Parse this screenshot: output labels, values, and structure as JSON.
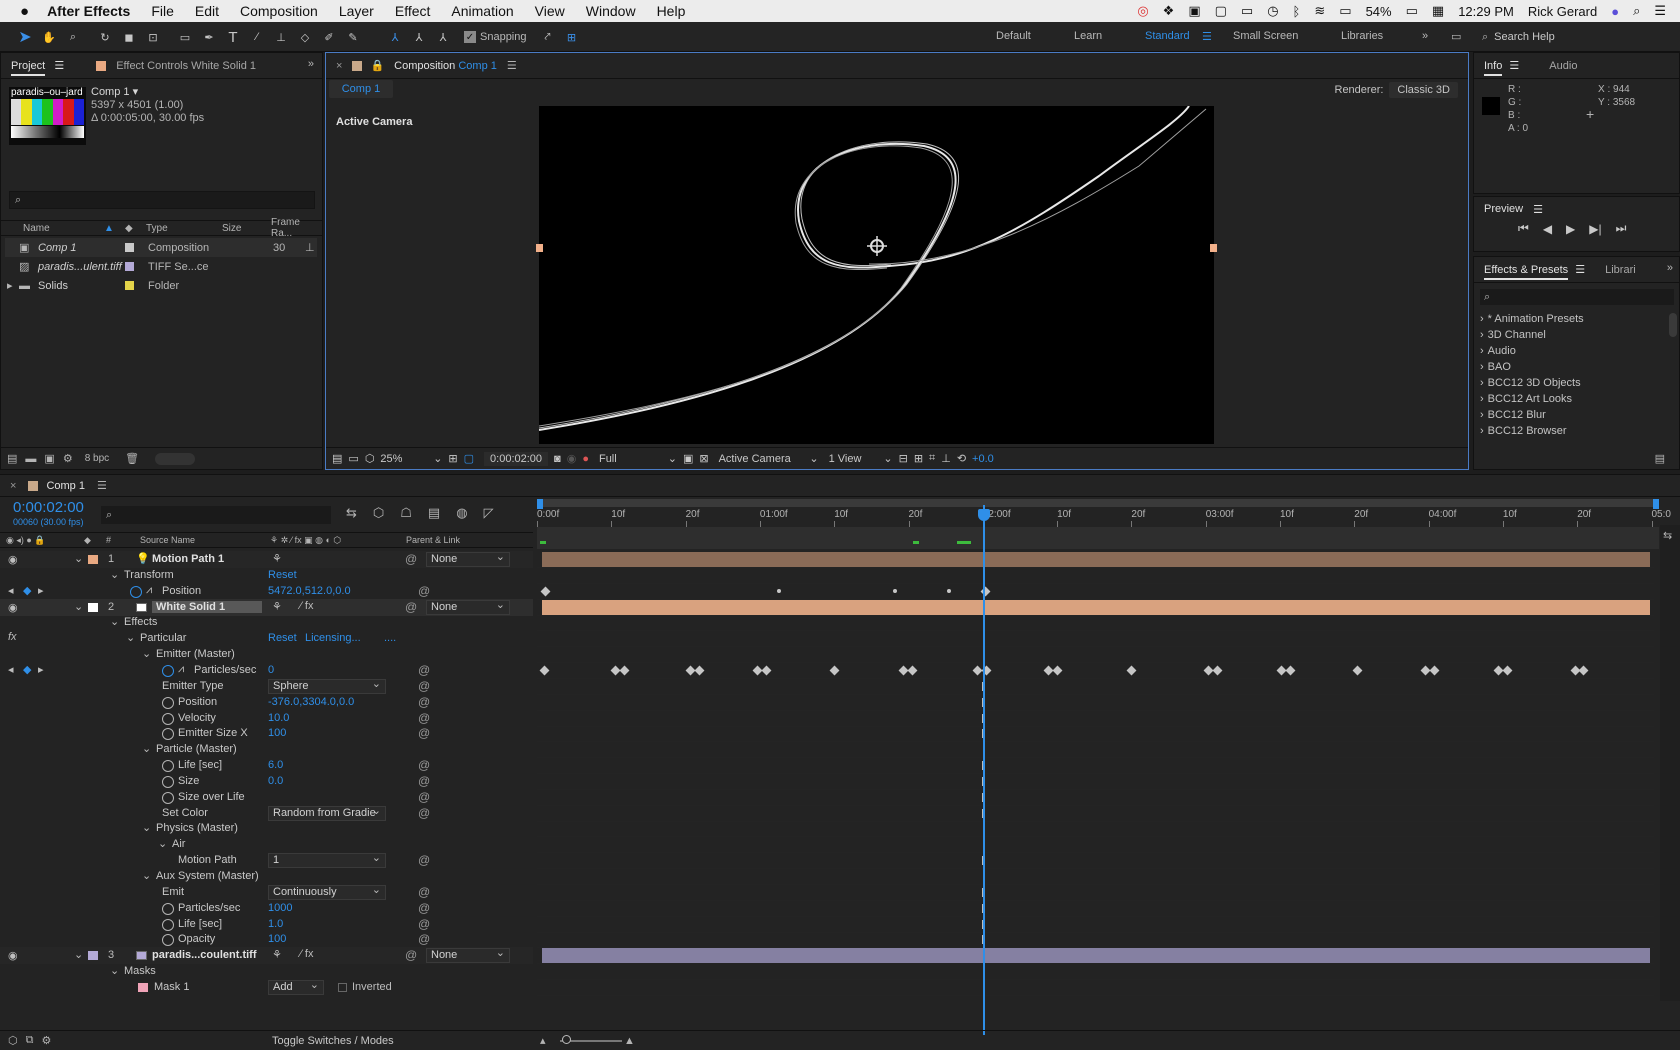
{
  "menubar": {
    "app_name": "After Effects",
    "menus": [
      "File",
      "Edit",
      "Composition",
      "Layer",
      "Effect",
      "Animation",
      "View",
      "Window",
      "Help"
    ],
    "battery": "54%",
    "clock": "12:29 PM",
    "user": "Rick Gerard"
  },
  "toolbar": {
    "snapping_label": "Snapping",
    "workspaces": [
      "Default",
      "Learn",
      "Standard",
      "Small Screen",
      "Libraries"
    ],
    "active_workspace": "Standard",
    "search_placeholder": "Search Help"
  },
  "project_panel": {
    "tab_project": "Project",
    "tab_effect_controls": "Effect Controls White Solid 1",
    "thumb_label": "paradis–ou–jard",
    "comp_name": "Comp 1 ▾",
    "comp_size": "5397 x 4501 (1.00)",
    "comp_duration": "Δ 0:00:05:00, 30.00 fps",
    "columns": [
      "Name",
      "Type",
      "Size",
      "Frame Ra..."
    ],
    "items": [
      {
        "name": "Comp 1",
        "type": "Composition",
        "size": "",
        "fps": "30",
        "color": "#c9c9c9"
      },
      {
        "name": "paradis...ulent.tiff",
        "type": "TIFF Se...ce",
        "size": "",
        "fps": "",
        "color": "#b3a9d6"
      },
      {
        "name": "Solids",
        "type": "Folder",
        "size": "",
        "fps": "",
        "color": "#e4d44a"
      }
    ],
    "bpc": "8 bpc"
  },
  "composition_panel": {
    "tab_prefix": "Composition",
    "tab_comp": "Comp 1",
    "subtab": "Comp 1",
    "renderer_label": "Renderer:",
    "renderer_value": "Classic 3D",
    "view_label": "Active Camera",
    "zoom": "25%",
    "timecode": "0:00:02:00",
    "resolution": "Full",
    "camera": "Active Camera",
    "views": "1 View",
    "exposure": "+0.0"
  },
  "info_panel": {
    "tab_info": "Info",
    "tab_audio": "Audio",
    "r": "R :",
    "g": "G :",
    "b": "B :",
    "a": "A :  0",
    "x": "X : 944",
    "y": "Y : 3568"
  },
  "preview_panel": {
    "title": "Preview"
  },
  "effects_panel": {
    "tab": "Effects & Presets",
    "tab2": "Librari",
    "items": [
      "* Animation Presets",
      "3D Channel",
      "Audio",
      "BAO",
      "BCC12 3D Objects",
      "BCC12 Art Looks",
      "BCC12 Blur",
      "BCC12 Browser"
    ]
  },
  "timeline": {
    "tab": "Comp 1",
    "timecode": "0:00:02:00",
    "frames": "00060 (30.00 fps)",
    "col_source": "Source Name",
    "col_parent": "Parent & Link",
    "ruler": [
      "0:00f",
      "10f",
      "20f",
      "01:00f",
      "10f",
      "20f",
      "02:00f",
      "10f",
      "20f",
      "03:00f",
      "10f",
      "20f",
      "04:00f",
      "10f",
      "20f",
      "05:0"
    ],
    "toggle_label": "Toggle Switches / Modes",
    "rows": [
      {
        "indent": 0,
        "num": "1",
        "name": "Motion Path 1",
        "kind": "layer",
        "parent": "None",
        "color": "#e9a982"
      },
      {
        "indent": 1,
        "name": "Transform",
        "value": "Reset",
        "kind": "group"
      },
      {
        "indent": 2,
        "name": "Position",
        "value": "5472.0,512.0,0.0",
        "kind": "prop",
        "stopwatch": true,
        "graph": true,
        "keynav": true
      },
      {
        "indent": 0,
        "num": "2",
        "name": "White Solid 1",
        "kind": "layer",
        "parent": "None",
        "color": "#ffffff",
        "selected": true
      },
      {
        "indent": 1,
        "name": "Effects",
        "kind": "group"
      },
      {
        "indent": 2,
        "name": "Particular",
        "value": "Reset",
        "value2": "Licensing...",
        "value3": "....",
        "kind": "group",
        "fx": true
      },
      {
        "indent": 3,
        "name": "Emitter (Master)",
        "kind": "group"
      },
      {
        "indent": 4,
        "name": "Particles/sec",
        "value": "0",
        "kind": "prop",
        "stopwatch": true,
        "graph": true,
        "keynav": true
      },
      {
        "indent": 4,
        "name": "Emitter Type",
        "dropdown": "Sphere",
        "kind": "prop"
      },
      {
        "indent": 4,
        "name": "Position",
        "value": "-376.0,3304.0,0.0",
        "kind": "prop",
        "stopwatch": true
      },
      {
        "indent": 4,
        "name": "Velocity",
        "value": "10.0",
        "kind": "prop",
        "stopwatch": true
      },
      {
        "indent": 4,
        "name": "Emitter Size X",
        "value": "100",
        "kind": "prop",
        "stopwatch": true
      },
      {
        "indent": 3,
        "name": "Particle (Master)",
        "kind": "group"
      },
      {
        "indent": 4,
        "name": "Life [sec]",
        "value": "6.0",
        "kind": "prop",
        "stopwatch": true
      },
      {
        "indent": 4,
        "name": "Size",
        "value": "0.0",
        "kind": "prop",
        "stopwatch": true
      },
      {
        "indent": 4,
        "name": "Size over Life",
        "kind": "prop",
        "stopwatch": true
      },
      {
        "indent": 4,
        "name": "Set Color",
        "dropdown": "Random from Gradie",
        "kind": "prop",
        "nostop": true
      },
      {
        "indent": 3,
        "name": "Physics (Master)",
        "kind": "group"
      },
      {
        "indent": 4,
        "name": "Air",
        "kind": "group"
      },
      {
        "indent": 5,
        "name": "Motion Path",
        "dropdown": "1",
        "kind": "prop",
        "nostop": true
      },
      {
        "indent": 3,
        "name": "Aux System (Master)",
        "kind": "group"
      },
      {
        "indent": 4,
        "name": "Emit",
        "dropdown": "Continuously",
        "kind": "prop",
        "nostop": true
      },
      {
        "indent": 4,
        "name": "Particles/sec",
        "value": "1000",
        "kind": "prop",
        "stopwatch": true
      },
      {
        "indent": 4,
        "name": "Life [sec]",
        "value": "1.0",
        "kind": "prop",
        "stopwatch": true
      },
      {
        "indent": 4,
        "name": "Opacity",
        "value": "100",
        "kind": "prop",
        "stopwatch": true
      },
      {
        "indent": 0,
        "num": "3",
        "name": "paradis...coulent.tiff",
        "kind": "layer",
        "parent": "None",
        "color": "#b3a9d6"
      },
      {
        "indent": 1,
        "name": "Masks",
        "kind": "group"
      },
      {
        "indent": 2,
        "name": "Mask 1",
        "dropdown": "Add",
        "extra": "Inverted",
        "kind": "prop",
        "nostop": true,
        "maskcolor": "#f0a4b8"
      }
    ]
  }
}
